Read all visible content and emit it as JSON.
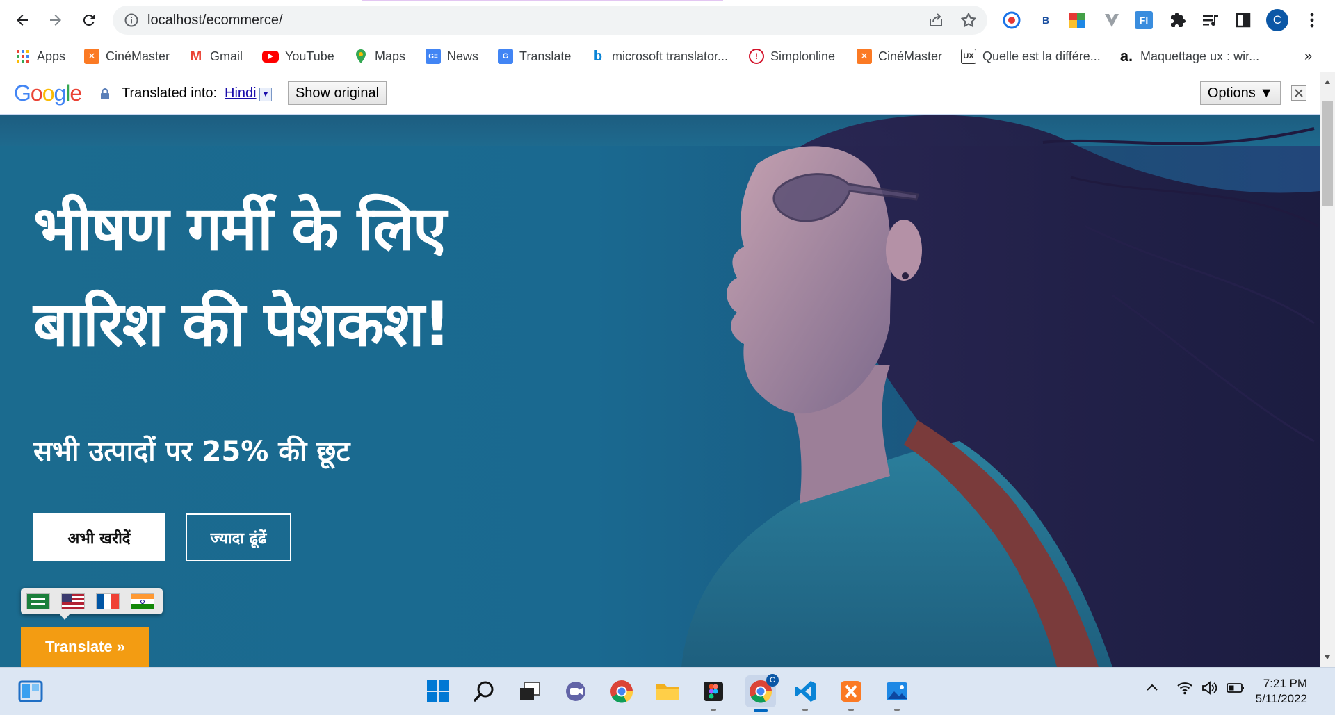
{
  "browser": {
    "url": "localhost/ecommerce/",
    "profile_initial": "C",
    "extension_badge_b": "B",
    "extension_fi": "FI"
  },
  "bookmarks": [
    {
      "label": "Apps"
    },
    {
      "label": "CinéMaster"
    },
    {
      "label": "Gmail"
    },
    {
      "label": "YouTube"
    },
    {
      "label": "Maps"
    },
    {
      "label": "News"
    },
    {
      "label": "Translate"
    },
    {
      "label": "microsoft translator..."
    },
    {
      "label": "Simplonline"
    },
    {
      "label": "CinéMaster"
    },
    {
      "label": "Quelle est la différe..."
    },
    {
      "label": "Maquettage ux : wir..."
    }
  ],
  "bookmarks_overflow": "»",
  "translate_bar": {
    "logo": "Google",
    "translated_into": "Translated into:",
    "language": "Hindi",
    "show_original": "Show original",
    "options": "Options ▼"
  },
  "hero": {
    "headline_line1": "भीषण गर्मी के लिए",
    "headline_line2": "बारिश की पेशकश!",
    "subheadline": "सभी उत्पादों पर 25% की छूट",
    "shop_now": "अभी खरीदें",
    "find_more": "ज्यादा ढूंढें"
  },
  "translate_widget": {
    "button": "Translate »",
    "flags": [
      "arabic-flag",
      "us-flag",
      "france-flag",
      "india-flag"
    ]
  },
  "taskbar": {
    "time": "7:21 PM",
    "date": "5/11/2022",
    "chrome_badge": "C"
  }
}
